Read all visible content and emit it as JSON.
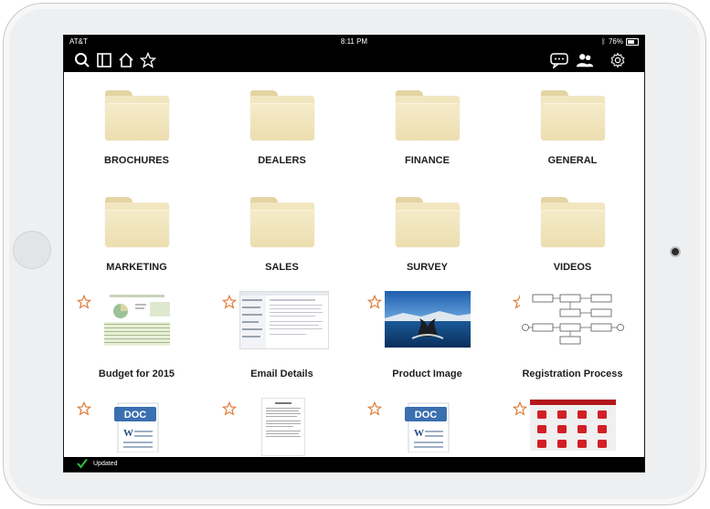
{
  "status": {
    "carrier": "AT&T",
    "time": "8:11 PM",
    "battery": "76%"
  },
  "toolbar": {
    "left_icons": [
      "search-icon",
      "sidebar-icon",
      "home-icon",
      "star-icon"
    ],
    "right_icons": [
      "chat-icon",
      "users-icon",
      "gear-icon"
    ]
  },
  "folders": [
    {
      "label": "BROCHURES"
    },
    {
      "label": "DEALERS"
    },
    {
      "label": "FINANCE"
    },
    {
      "label": "GENERAL"
    },
    {
      "label": "MARKETING"
    },
    {
      "label": "SALES"
    },
    {
      "label": "SURVEY"
    },
    {
      "label": "VIDEOS"
    }
  ],
  "files": [
    {
      "label": "Budget for 2015",
      "thumb": "spreadsheet"
    },
    {
      "label": "Email Details",
      "thumb": "email"
    },
    {
      "label": "Product Image",
      "thumb": "photo"
    },
    {
      "label": "Registration Process",
      "thumb": "flowchart"
    }
  ],
  "files_row2": [
    {
      "thumb": "doc",
      "badge": "DOC"
    },
    {
      "thumb": "text-page"
    },
    {
      "thumb": "doc",
      "badge": "DOC"
    },
    {
      "thumb": "app-grid"
    }
  ],
  "footer": {
    "status_text": "Updated"
  },
  "colors": {
    "star": "#e07a3a",
    "folder": "#efe2b6",
    "bar": "#000000",
    "doc_blue": "#3a6fb0",
    "check": "#2fbf3a"
  }
}
